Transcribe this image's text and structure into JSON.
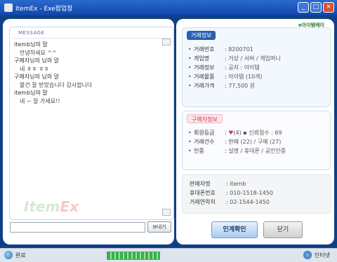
{
  "window": {
    "title": "ItemEx - Exe팝업창",
    "controls": [
      "_",
      "□",
      "×"
    ]
  },
  "chat": {
    "header": "MESSAGE",
    "messages": [
      {
        "text": "itemb님의 말",
        "type": "speaker"
      },
      {
        "text": "안녕하세요 ^^",
        "type": "body"
      },
      {
        "text": "구매자님의 님의 말",
        "type": "speaker"
      },
      {
        "text": "네 ㅎㅎ ㅎㅎ",
        "type": "body"
      },
      {
        "text": "구매자님의 님의 말",
        "type": "speaker"
      },
      {
        "text": "물건 잘 받았습니다 감사합니다",
        "type": "body"
      },
      {
        "text": "itemb님의 말",
        "type": "speaker"
      },
      {
        "text": "네 ~ 잘 가세요!!",
        "type": "body"
      }
    ],
    "watermark_main": "Item",
    "watermark_accent": "Ex",
    "input_value": "",
    "send_label": "보내기"
  },
  "logo": {
    "brand_a": "e",
    "brand_b": "아이템베이"
  },
  "trade_info": {
    "title": "거래정보",
    "rows": [
      {
        "label": "거래번호",
        "value": "8200701"
      },
      {
        "label": "게임명",
        "value": "거상 / 서버 / 게임머니"
      },
      {
        "label": "거래정보",
        "value": "공지 : 아이템"
      },
      {
        "label": "거래물품",
        "value": "아이템 (10개)"
      },
      {
        "label": "거래가격",
        "value": "77,500 원"
      }
    ]
  },
  "buyer_info": {
    "title": "구매자정보",
    "rows": [
      {
        "label": "회원등급",
        "value_heart": "♥",
        "value": "(4) ▪ 신뢰점수 : 69"
      },
      {
        "label": "거래건수",
        "value": "판매 (22) / 구매 (27)"
      },
      {
        "label": "인증",
        "value": "실명 / 휴대폰 / 공인인증"
      }
    ]
  },
  "seller_info": {
    "rows": [
      {
        "label": "판매자명",
        "value": "itemb"
      },
      {
        "label": "휴대폰번호",
        "value": "010-1518-1450"
      },
      {
        "label": "거래연락처",
        "value": "02-1544-1450"
      }
    ]
  },
  "buttons": {
    "confirm": "인계확인",
    "close": "닫기"
  },
  "status": {
    "left_text": "완료",
    "right_text": "인터넷",
    "progress": 1.0
  }
}
